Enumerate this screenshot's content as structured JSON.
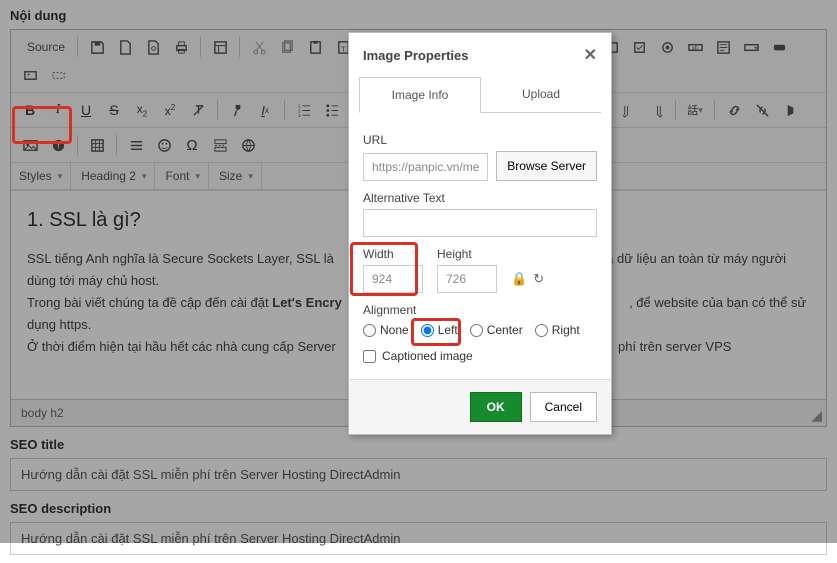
{
  "labels": {
    "content": "Nội dung",
    "seo_title": "SEO title",
    "seo_desc": "SEO description"
  },
  "toolbar": {
    "source": "Source",
    "styles": "Styles",
    "heading": "Heading 2",
    "font": "Font",
    "size": "Size"
  },
  "content": {
    "h2": "1. SSL là gì?",
    "p1a": "SSL tiếng Anh nghĩa là Secure Sockets Layer, SSL là",
    "p1b": "a dữ liệu an toàn từ máy người dùng tới máy chủ host.",
    "p2a": "Trong bài viết chúng ta đề cập đến cài đặt ",
    "p2b": "Let's Encry",
    "p2c": ", để website của bạn có thể sử dụng https.",
    "p3": "Ở thời điểm hiện tại hầu hết các nhà cung cấp Server",
    "p3b": "phí trên server VPS",
    "status": "body   h2"
  },
  "seo": {
    "title_val": "Hướng dẫn cài đặt SSL miễn phí trên Server Hosting DirectAdmin",
    "desc_val": "Hướng dẫn cài đặt SSL miễn phí trên Server Hosting DirectAdmin"
  },
  "dialog": {
    "title": "Image Properties",
    "tab_info": "Image Info",
    "tab_upload": "Upload",
    "url_label": "URL",
    "url_placeholder": "https://panpic.vn/me",
    "browse": "Browse Server",
    "alt_label": "Alternative Text",
    "width_label": "Width",
    "width_val": "924",
    "height_label": "Height",
    "height_val": "726",
    "align_label": "Alignment",
    "align_none": "None",
    "align_left": "Left",
    "align_center": "Center",
    "align_right": "Right",
    "captioned": "Captioned image",
    "ok": "OK",
    "cancel": "Cancel"
  }
}
